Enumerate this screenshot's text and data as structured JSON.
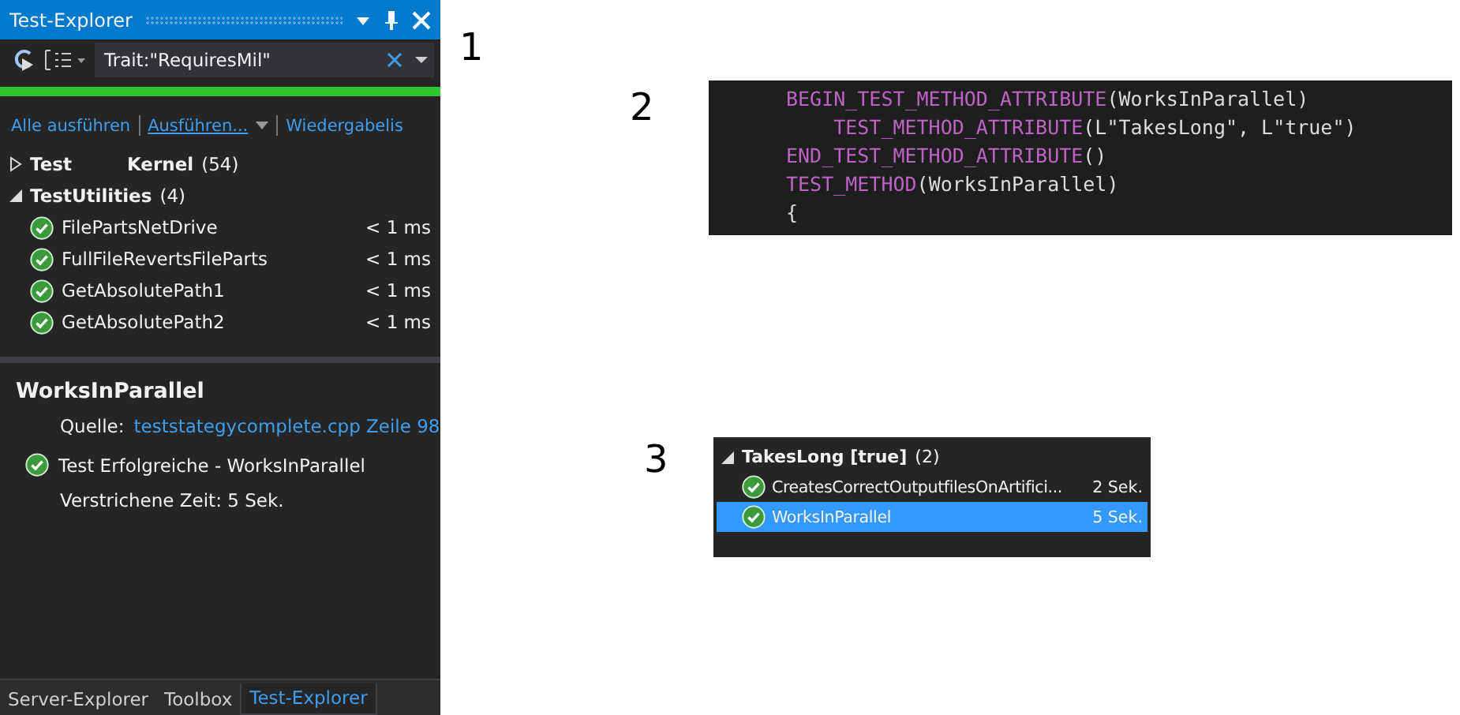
{
  "panel": {
    "title": "Test-Explorer",
    "search": {
      "value": "Trait:\"RequiresMil\""
    },
    "progress": {
      "level": 1
    },
    "actions": [
      {
        "label": "Alle ausführen",
        "kind": "link"
      },
      {
        "label": "Ausführen...",
        "kind": "dropdown"
      },
      {
        "label": "Wiedergabelis",
        "kind": "link"
      }
    ],
    "tree": [
      {
        "name_parts": [
          "Test",
          "Kernel"
        ],
        "count": "(54)",
        "expanded": false
      },
      {
        "name_parts": [
          "TestUtilities"
        ],
        "count": "(4)",
        "expanded": true,
        "children": [
          {
            "name": "FilePartsNetDrive",
            "time": "< 1 ms"
          },
          {
            "name": "FullFileRevertsFileParts",
            "time": "< 1 ms"
          },
          {
            "name": "GetAbsolutePath1",
            "time": "< 1 ms"
          },
          {
            "name": "GetAbsolutePath2",
            "time": "< 1 ms"
          }
        ]
      }
    ],
    "details": {
      "title": "WorksInParallel",
      "source_label": "Quelle:",
      "source_link": "teststategycomplete.cpp Zeile 98",
      "result": "Test Erfolgreiche - WorksInParallel",
      "elapsed": "Verstrichene Zeit: 5 Sek."
    },
    "bottom_tabs": [
      {
        "label": "Server-Explorer",
        "selected": false
      },
      {
        "label": "Toolbox",
        "selected": false
      },
      {
        "label": "Test-Explorer",
        "selected": true
      }
    ]
  },
  "callouts": [
    "1",
    "2",
    "3"
  ],
  "code": [
    [
      {
        "kind": "macro",
        "text": "BEGIN_TEST_METHOD_ATTRIBUTE"
      },
      {
        "kind": "plain",
        "text": "(WorksInParallel)"
      }
    ],
    [
      {
        "kind": "macro",
        "text": "    TEST_METHOD_ATTRIBUTE"
      },
      {
        "kind": "plain",
        "text": "(L\"TakesLong\", L\"true\")"
      }
    ],
    [
      {
        "kind": "macro",
        "text": "END_TEST_METHOD_ATTRIBUTE"
      },
      {
        "kind": "plain",
        "text": "()"
      }
    ],
    [
      {
        "kind": "macro",
        "text": "TEST_METHOD"
      },
      {
        "kind": "plain",
        "text": "(WorksInParallel)"
      }
    ],
    [
      {
        "kind": "plain",
        "text": "{"
      }
    ]
  ],
  "group": {
    "name": "TakesLong [true]",
    "count": "(2)",
    "expanded": true,
    "children": [
      {
        "name": "CreatesCorrectOutputfilesOnArtifici...",
        "time": "2 Sek.",
        "selected": false
      },
      {
        "name": "WorksInParallel",
        "time": "5 Sek.",
        "selected": true
      }
    ]
  }
}
